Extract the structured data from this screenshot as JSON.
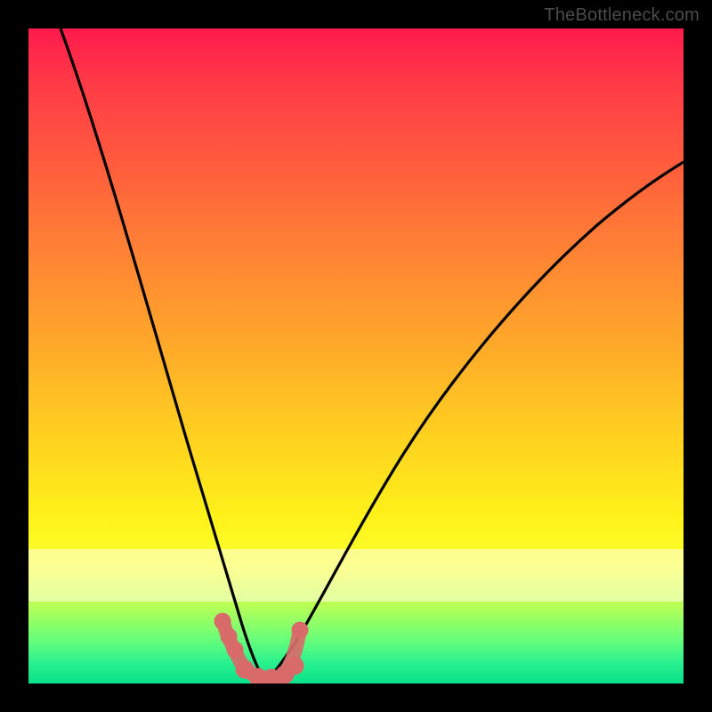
{
  "attribution": "TheBottleneck.com",
  "chart_data": {
    "type": "line",
    "title": "",
    "xlabel": "",
    "ylabel": "",
    "xlim": [
      0,
      100
    ],
    "ylim": [
      0,
      100
    ],
    "series": [
      {
        "name": "bottleneck-curve-left",
        "x": [
          5,
          10,
          15,
          20,
          23,
          26,
          28,
          30,
          32,
          34,
          36
        ],
        "y": [
          100,
          82,
          63,
          44,
          31,
          20,
          12,
          6,
          2,
          0.5,
          0
        ]
      },
      {
        "name": "bottleneck-curve-right",
        "x": [
          36,
          38,
          40,
          45,
          50,
          55,
          60,
          70,
          80,
          90,
          100
        ],
        "y": [
          0,
          1,
          3,
          10,
          19,
          28,
          36,
          50,
          62,
          72,
          80
        ]
      },
      {
        "name": "optimal-markers",
        "x": [
          29.5,
          30.5,
          31.5,
          33,
          35,
          37,
          39,
          40.5,
          41
        ],
        "y": [
          9,
          7,
          5,
          1.5,
          0.5,
          0.5,
          1,
          2.5,
          8
        ]
      }
    ],
    "background_gradient": {
      "top": "#ff1a4d",
      "upper_mid": "#ffa82a",
      "mid": "#fff31a",
      "bottom": "#0ae08b"
    },
    "marker_color": "#d86a6a",
    "curve_color": "#000000"
  }
}
